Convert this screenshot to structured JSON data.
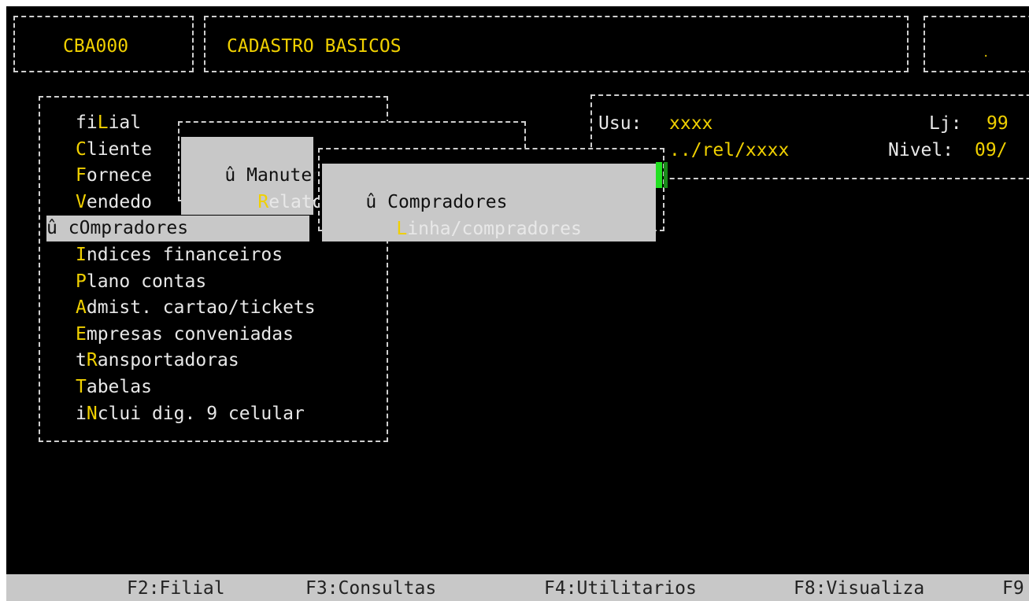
{
  "header": {
    "program_code": "CBA000",
    "program_title": "CADASTRO BASICOS",
    "right_box_text": "."
  },
  "main_menu": {
    "items": [
      {
        "prefix": "fi",
        "hotkey": "L",
        "rest": "ial",
        "selected": false
      },
      {
        "prefix": "",
        "hotkey": "C",
        "rest": "liente",
        "selected": false
      },
      {
        "prefix": "",
        "hotkey": "F",
        "rest": "ornece",
        "selected": false
      },
      {
        "prefix": "",
        "hotkey": "V",
        "rest": "endedo",
        "selected": false
      },
      {
        "prefix": "c",
        "hotkey": "O",
        "rest": "mpradores",
        "selected": true,
        "marker": "û"
      },
      {
        "prefix": "",
        "hotkey": "I",
        "rest": "ndices financeiros",
        "selected": false
      },
      {
        "prefix": "",
        "hotkey": "P",
        "rest": "lano contas",
        "selected": false
      },
      {
        "prefix": "",
        "hotkey": "A",
        "rest": "dmist. cartao/tickets",
        "selected": false
      },
      {
        "prefix": "",
        "hotkey": "E",
        "rest": "mpresas conveniadas",
        "selected": false
      },
      {
        "prefix": "t",
        "hotkey": "R",
        "rest": "ansportadoras",
        "selected": false
      },
      {
        "prefix": "",
        "hotkey": "T",
        "rest": "abelas",
        "selected": false
      },
      {
        "prefix": "i",
        "hotkey": "N",
        "rest": "clui dig. 9 celular",
        "selected": false
      }
    ]
  },
  "submenu": {
    "marker": "û",
    "item1_label": "Manuten",
    "item2_hotkey": "R",
    "item2_rest": "elator"
  },
  "submenu2": {
    "marker": "û",
    "item1_label": "Compradores",
    "item2_hotkey": "L",
    "item2_rest": "inha/compradores"
  },
  "info_panel": {
    "usu_label": "Usu:",
    "usu_value": "xxxx",
    "lj_label": "Lj:",
    "lj_value": "99",
    "path_value": "../rel/xxxx",
    "nivel_label": "Nivel:",
    "nivel_value": "09/"
  },
  "status_bar": {
    "keys": [
      "F2:Filial",
      "F3:Consultas",
      "F4:Utilitarios",
      "F8:Visualiza",
      "F9"
    ]
  },
  "colors": {
    "background": "#000000",
    "hotkey": "#f0d000",
    "highlight": "#c8c8c8",
    "cursor": "#22e022"
  }
}
